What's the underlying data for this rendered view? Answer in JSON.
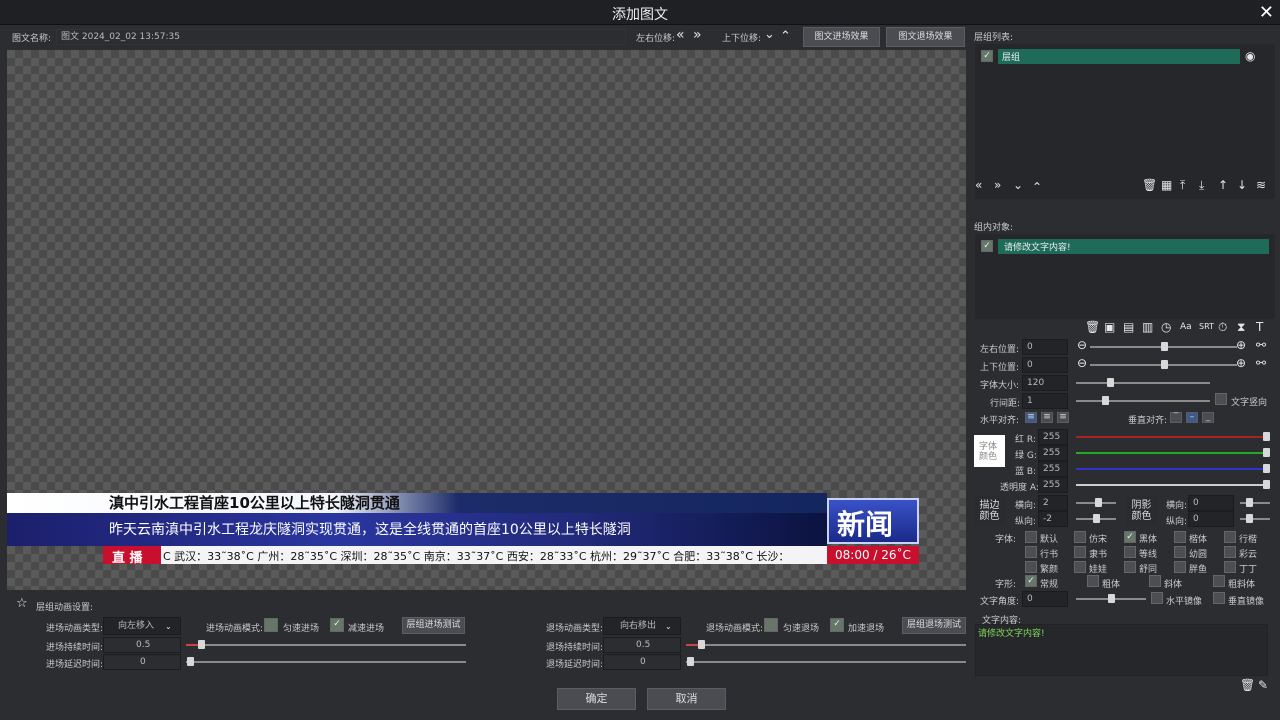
{
  "window": {
    "title": "添加图文",
    "close": "✕"
  },
  "toolbar": {
    "name_label": "图文名称:",
    "name_value": "图文 2024_02_02 13:57:35",
    "lr_label": "左右位移:",
    "ud_label": "上下位移:",
    "enter_btn": "图文进场效果",
    "exit_btn": "图文退场效果"
  },
  "news": {
    "headline": "滇中引水工程首座10公里以上特长隧洞贯通",
    "subline": "昨天云南滇中引水工程龙庆隧洞实现贯通，这是全线贯通的首座10公里以上特长隧洞",
    "live": "直 播",
    "ticker": "C 武汉：33˜38˚C 广州：28˜35˚C 深圳：28˜35˚C 南京：33˜37˚C 西安：28˜33˚C 杭州：29˜37˚C 合肥：33˜38˚C 长沙：",
    "logo": "新闻",
    "time": "08:00 / 26˚C"
  },
  "layers": {
    "title": "层组列表:",
    "item": "层组"
  },
  "objects": {
    "title": "组内对象:",
    "item": "请修改文字内容!"
  },
  "props": {
    "x_label": "左右位置:",
    "x_value": "0",
    "y_label": "上下位置:",
    "y_value": "0",
    "size_label": "字体大小:",
    "size_value": "120",
    "line_label": "行间距:",
    "line_value": "1",
    "vertical_text": "文字竖向",
    "halign_label": "水平对齐:",
    "valign_label": "垂直对齐:",
    "font_color": "字体颜色",
    "r_label": "红 R:",
    "r": "255",
    "g_label": "绿 G:",
    "g": "255",
    "b_label": "蓝 B:",
    "b": "255",
    "a_label": "透明度 A:",
    "a": "255",
    "stroke_color": "描边颜色",
    "shadow_color": "阴影颜色",
    "h_label": "横向:",
    "v_label": "纵向:",
    "stroke_h": "2",
    "stroke_v": "-2",
    "shadow_h": "0",
    "shadow_v": "0",
    "font_label": "字体:",
    "fonts": [
      "默认",
      "仿宋",
      "黑体",
      "楷体",
      "行楷",
      "行书",
      "隶书",
      "等线",
      "幼圆",
      "彩云",
      "繁颜",
      "娃娃",
      "舒同",
      "胖鱼",
      "丁丁"
    ],
    "style_label": "字形:",
    "styles": [
      "常规",
      "粗体",
      "斜体",
      "粗斜体"
    ],
    "angle_label": "文字角度:",
    "angle_value": "0",
    "hmirror": "水平镜像",
    "vmirror": "垂直镜像",
    "content_label": "文字内容:",
    "content_value": "请修改文字内容!"
  },
  "anim": {
    "title": "层组动画设置:",
    "in_type_label": "进场动画类型:",
    "in_type": "向左移入",
    "in_mode_label": "进场动画模式:",
    "uniform_in": "匀速进场",
    "decel_in": "减速进场",
    "in_test": "层组进场测试",
    "in_dur_label": "进场持续时间:",
    "in_dur": "0.5",
    "in_delay_label": "进场延迟时间:",
    "in_delay": "0",
    "out_type_label": "退场动画类型:",
    "out_type": "向右移出",
    "out_mode_label": "退场动画模式:",
    "uniform_out": "匀速退场",
    "accel_out": "加速退场",
    "out_test": "层组退场测试",
    "out_dur_label": "退场持续时间:",
    "out_dur": "0.5",
    "out_delay_label": "退场延迟时间:",
    "out_delay": "0"
  },
  "footer": {
    "ok": "确定",
    "cancel": "取消"
  }
}
